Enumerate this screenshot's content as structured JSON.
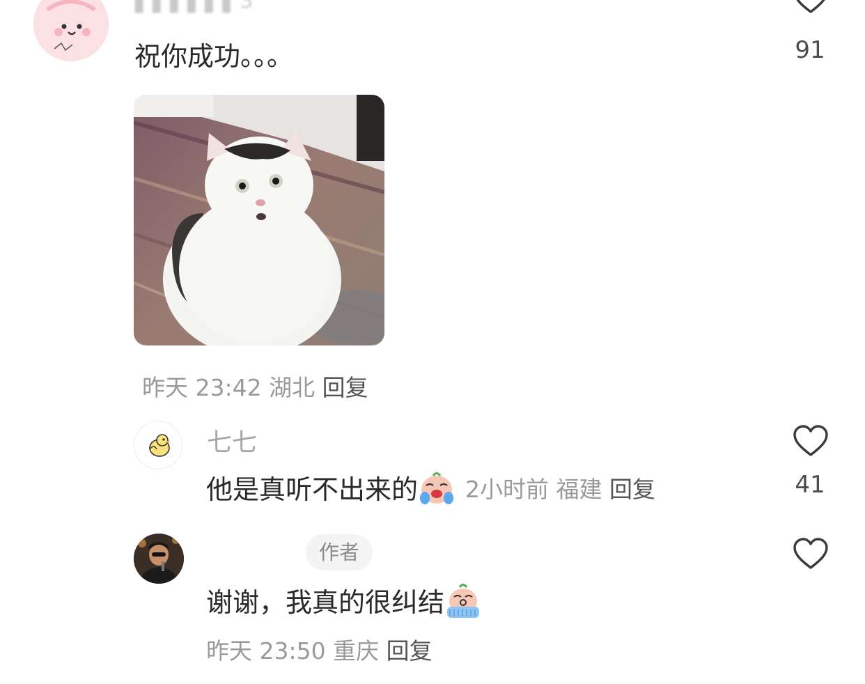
{
  "comment": {
    "username": "▌▌▌▌▌▌3",
    "text": "祝你成功。。。",
    "like_count": "91",
    "meta": {
      "time": "昨天 23:42",
      "location": "湖北",
      "reply_label": "回复"
    }
  },
  "replies": [
    {
      "username": "七七",
      "text": "他是真听不出来的",
      "emoji": "crying-face-emoji",
      "meta": {
        "time": "2小时前",
        "location": "福建",
        "reply_label": "回复"
      },
      "like_count": "41"
    },
    {
      "username": "",
      "badge": "作者",
      "text": "谢谢，我真的很纠结",
      "emoji": "sobbing-face-emoji",
      "meta": {
        "time": "昨天 23:50",
        "location": "重庆",
        "reply_label": "回复"
      },
      "like_count": ""
    }
  ],
  "icons": {
    "like": "heart-outline-icon"
  },
  "colors": {
    "text_primary": "#2a2a2a",
    "text_secondary": "#9a9a9a",
    "username": "#a6a6a6",
    "badge_bg": "#f4f4f4"
  }
}
